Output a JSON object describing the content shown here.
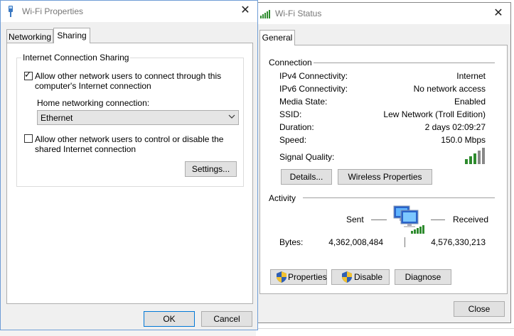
{
  "wifi_properties": {
    "title": "Wi-Fi Properties",
    "tabs": [
      "Networking",
      "Sharing"
    ],
    "active_tab": "Sharing",
    "group_title": "Internet Connection Sharing",
    "allow_connect_label_line1": "Allow other network users to connect through this",
    "allow_connect_label_line2": "computer's Internet connection",
    "allow_connect_checked": true,
    "home_networking_label": "Home networking connection:",
    "home_networking_value": "Ethernet",
    "allow_control_label_line1": "Allow other network users to control or disable the",
    "allow_control_label_line2": "shared Internet connection",
    "allow_control_checked": false,
    "settings_button": "Settings...",
    "ok_button": "OK",
    "cancel_button": "Cancel"
  },
  "wifi_status": {
    "title": "Wi-Fi Status",
    "tab": "General",
    "connection_header": "Connection",
    "connection_rows": [
      {
        "label": "IPv4 Connectivity:",
        "value": "Internet"
      },
      {
        "label": "IPv6 Connectivity:",
        "value": "No network access"
      },
      {
        "label": "Media State:",
        "value": "Enabled"
      },
      {
        "label": "SSID:",
        "value": "Lew Network (Troll Edition)"
      },
      {
        "label": "Duration:",
        "value": "2 days 02:09:27"
      },
      {
        "label": "Speed:",
        "value": "150.0 Mbps"
      }
    ],
    "signal_quality_label": "Signal Quality:",
    "signal_bars": 5,
    "details_button": "Details...",
    "wireless_properties_button": "Wireless Properties",
    "activity_header": "Activity",
    "sent_label": "Sent",
    "received_label": "Received",
    "bytes_label": "Bytes:",
    "bytes_sent": "4,362,008,484",
    "bytes_received": "4,576,330,213",
    "properties_button": "Properties",
    "disable_button": "Disable",
    "diagnose_button": "Diagnose",
    "close_button": "Close"
  },
  "colors": {
    "signal_green": "#2e8b2e",
    "focus_blue": "#0078d7",
    "shield_blue": "#2f5fb3",
    "shield_yellow": "#f2c230"
  }
}
